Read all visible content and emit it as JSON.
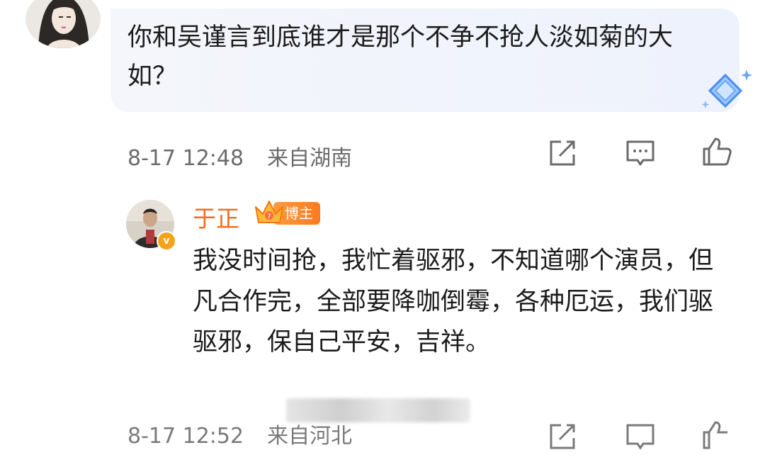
{
  "comment": {
    "text": "你和吴谨言到底谁才是那个不争不抢人淡如菊的大如？",
    "date": "8-17 12:48",
    "location": "来自湖南",
    "icons": [
      "share-icon",
      "comment-icon",
      "like-icon"
    ]
  },
  "reply": {
    "username": "于正",
    "badge_label": "博主",
    "verified_mark": "v",
    "text": "我没时间抢，我忙着驱邪，不知道哪个演员，但凡合作完，全部要降咖倒霉，各种厄运，我们驱驱邪，保自己平安，吉祥。",
    "colors": {
      "username": "#f26c1e",
      "badge": "#ff8a2b",
      "verified": "#f7a21b"
    }
  },
  "next_meta": {
    "date": "8-17 12:52",
    "location": "来自河北"
  }
}
